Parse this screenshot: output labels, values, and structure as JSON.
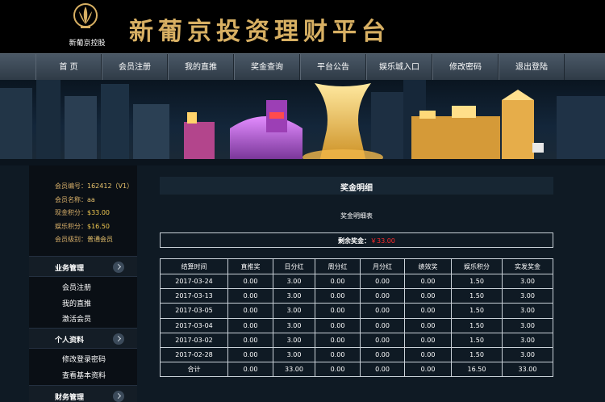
{
  "header": {
    "logo_text": "新葡京控股",
    "site_title": "新葡京投资理财平台"
  },
  "nav": {
    "items": [
      "首 页",
      "会员注册",
      "我的直推",
      "奖金查询",
      "平台公告",
      "娱乐城入口",
      "修改密码",
      "退出登陆"
    ]
  },
  "sidebar": {
    "info": [
      {
        "label": "会员编号：",
        "value": "162412（V1）"
      },
      {
        "label": "会员名称：",
        "value": "aa"
      },
      {
        "label": "现金积分：",
        "value": "$33.00"
      },
      {
        "label": "娱乐积分：",
        "value": "$16.50"
      },
      {
        "label": "会员级别：",
        "value": "普通会员"
      }
    ],
    "sections": [
      {
        "title": "业务管理",
        "items": [
          "会员注册",
          "我的直推",
          "激活会员"
        ]
      },
      {
        "title": "个人资料",
        "items": [
          "修改登录密码",
          "查看基本资料"
        ]
      },
      {
        "title": "财务管理",
        "items": []
      }
    ]
  },
  "main": {
    "panel_title": "奖金明细",
    "subtitle": "奖金明细表",
    "balance_label": "剩余奖金：",
    "balance_value": "￥33.00",
    "table": {
      "headers": [
        "结算时间",
        "直推奖",
        "日分红",
        "周分红",
        "月分红",
        "绩效奖",
        "娱乐积分",
        "实发奖金"
      ],
      "rows": [
        [
          "2017-03-24",
          "0.00",
          "3.00",
          "0.00",
          "0.00",
          "0.00",
          "1.50",
          "3.00"
        ],
        [
          "2017-03-13",
          "0.00",
          "3.00",
          "0.00",
          "0.00",
          "0.00",
          "1.50",
          "3.00"
        ],
        [
          "2017-03-05",
          "0.00",
          "3.00",
          "0.00",
          "0.00",
          "0.00",
          "1.50",
          "3.00"
        ],
        [
          "2017-03-04",
          "0.00",
          "3.00",
          "0.00",
          "0.00",
          "0.00",
          "1.50",
          "3.00"
        ],
        [
          "2017-03-02",
          "0.00",
          "3.00",
          "0.00",
          "0.00",
          "0.00",
          "1.50",
          "3.00"
        ],
        [
          "2017-02-28",
          "0.00",
          "3.00",
          "0.00",
          "0.00",
          "0.00",
          "1.50",
          "3.00"
        ],
        [
          "合计",
          "0.00",
          "33.00",
          "0.00",
          "0.00",
          "0.00",
          "16.50",
          "33.00"
        ]
      ]
    }
  },
  "colors": {
    "accent_gold": "#d8b063",
    "balance_red": "#ff2b2b",
    "nav_bg": "#3c4956"
  }
}
